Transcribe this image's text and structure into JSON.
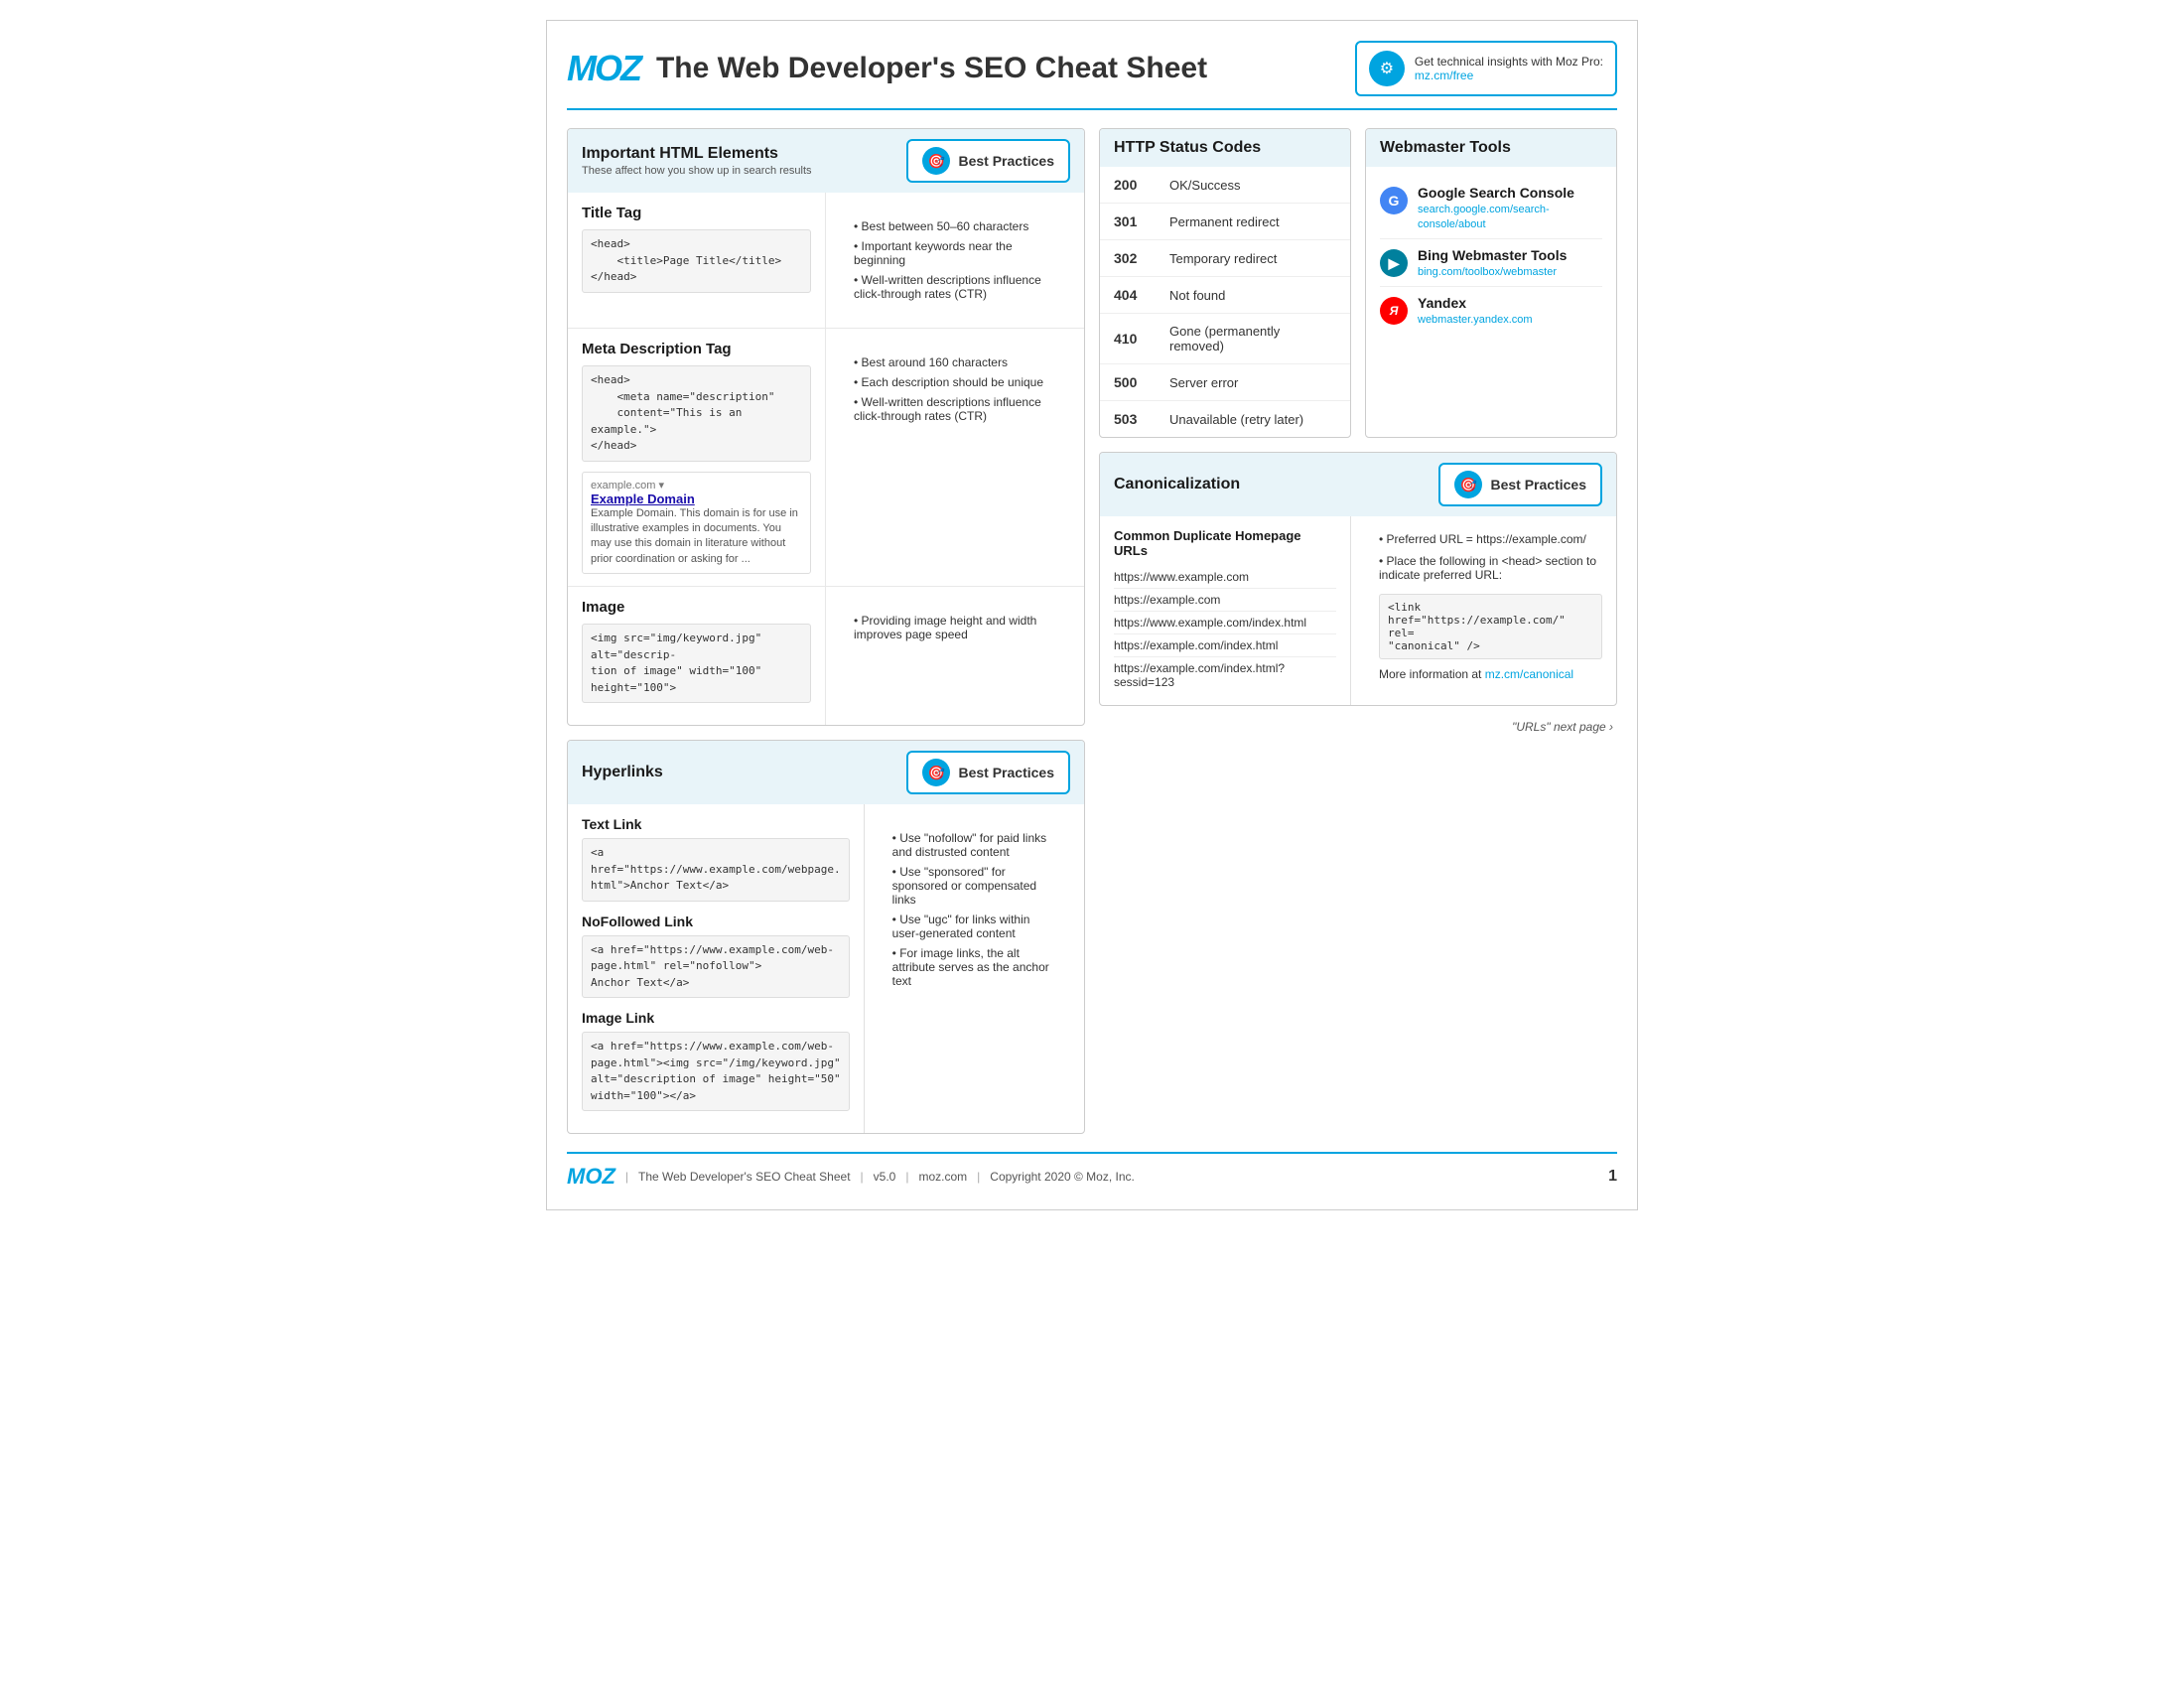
{
  "header": {
    "logo": "MOZ",
    "title": "The Web Developer's SEO Cheat Sheet",
    "promo_text": "Get technical insights with Moz Pro:",
    "promo_link": "mz.cm/free",
    "promo_icon": "⚙"
  },
  "html_elements": {
    "section_title": "Important HTML Elements",
    "section_subtitle": "These affect how you show up in search results",
    "best_practices_label": "Best Practices",
    "rows": [
      {
        "title": "Title Tag",
        "code": "<head>\n    <title>Page Title</title>\n</head>",
        "practices": [
          "Best between 50–60 characters",
          "Important keywords near the beginning",
          "Well-written descriptions influence click-through rates (CTR)"
        ]
      },
      {
        "title": "Meta Description Tag",
        "code": "<head>\n    <meta name=\"description\"\n    content=\"This is an example.\">\n</head>",
        "serp": {
          "url": "example.com ▾",
          "title": "Example Domain",
          "desc": "Example Domain. This domain is for use in illustrative examples in documents. You may use this domain in literature without prior coordination or asking for ..."
        },
        "practices": [
          "Best around 160 characters",
          "Each description should be unique",
          "Well-written descriptions influence click-through rates (CTR)"
        ]
      },
      {
        "title": "Image",
        "code": "<img src=\"img/keyword.jpg\" alt=\"descrip-\ntion of image\" width=\"100\" height=\"100\">",
        "practices": [
          "Providing image height and width improves page speed"
        ]
      }
    ]
  },
  "hyperlinks": {
    "section_title": "Hyperlinks",
    "best_practices_label": "Best Practices",
    "types": [
      {
        "title": "Text Link",
        "code": "<a href=\"https://www.example.com/webpage.\nhtml\">Anchor Text</a>"
      },
      {
        "title": "NoFollowed Link",
        "code": "<a href=\"https://www.example.com/web-\npage.html\" rel=\"nofollow\">\nAnchor Text</a>"
      },
      {
        "title": "Image Link",
        "code": "<a href=\"https://www.example.com/web-\npage.html\"><img src=\"/img/keyword.jpg\"\nalt=\"description of image\" height=\"50\"\nwidth=\"100\"></a>"
      }
    ],
    "practices": [
      "Use \"nofollow\" for paid links and distrusted content",
      "Use \"sponsored\" for sponsored or compensated links",
      "Use \"ugc\" for links within user-generated content",
      "For image links, the alt attribute serves as the anchor text"
    ]
  },
  "http_status": {
    "section_title": "HTTP Status Codes",
    "codes": [
      {
        "code": "200",
        "desc": "OK/Success"
      },
      {
        "code": "301",
        "desc": "Permanent redirect"
      },
      {
        "code": "302",
        "desc": "Temporary redirect"
      },
      {
        "code": "404",
        "desc": "Not found"
      },
      {
        "code": "410",
        "desc": "Gone (permanently removed)"
      },
      {
        "code": "500",
        "desc": "Server error"
      },
      {
        "code": "503",
        "desc": "Unavailable (retry later)"
      }
    ]
  },
  "webmaster_tools": {
    "section_title": "Webmaster Tools",
    "tools": [
      {
        "name": "Google Search Console",
        "icon": "G",
        "icon_class": "wm-google",
        "url": "search.google.com/search-console/about"
      },
      {
        "name": "Bing Webmaster Tools",
        "icon": "B",
        "icon_class": "wm-bing",
        "url": "bing.com/toolbox/webmaster"
      },
      {
        "name": "Yandex",
        "icon": "Y",
        "icon_class": "wm-yandex",
        "url": "webmaster.yandex.com"
      }
    ]
  },
  "canonicalization": {
    "section_title": "Canonicalization",
    "best_practices_label": "Best Practices",
    "duplicate_title": "Common Duplicate Homepage URLs",
    "urls": [
      "https://www.example.com",
      "https://example.com",
      "https://www.example.com/index.html",
      "https://example.com/index.html",
      "https://example.com/index.html?sessid=123"
    ],
    "practices": [
      "Preferred URL = https://example.com/",
      "Place the following in <head> section to indicate preferred URL:"
    ],
    "canon_code": "<link href=\"https://example.com/\" rel=\n\"canonical\" />",
    "more_info_text": "More information at ",
    "more_info_link": "mz.cm/canonical"
  },
  "footer": {
    "logo": "MOZ",
    "separator1": "|",
    "title": "The Web Developer's SEO Cheat Sheet",
    "separator2": "|",
    "version": "v5.0",
    "separator3": "|",
    "domain": "moz.com",
    "separator4": "|",
    "copyright": "Copyright 2020 © Moz, Inc.",
    "next_page": "\"URLs\" next page ›",
    "page_number": "1"
  }
}
